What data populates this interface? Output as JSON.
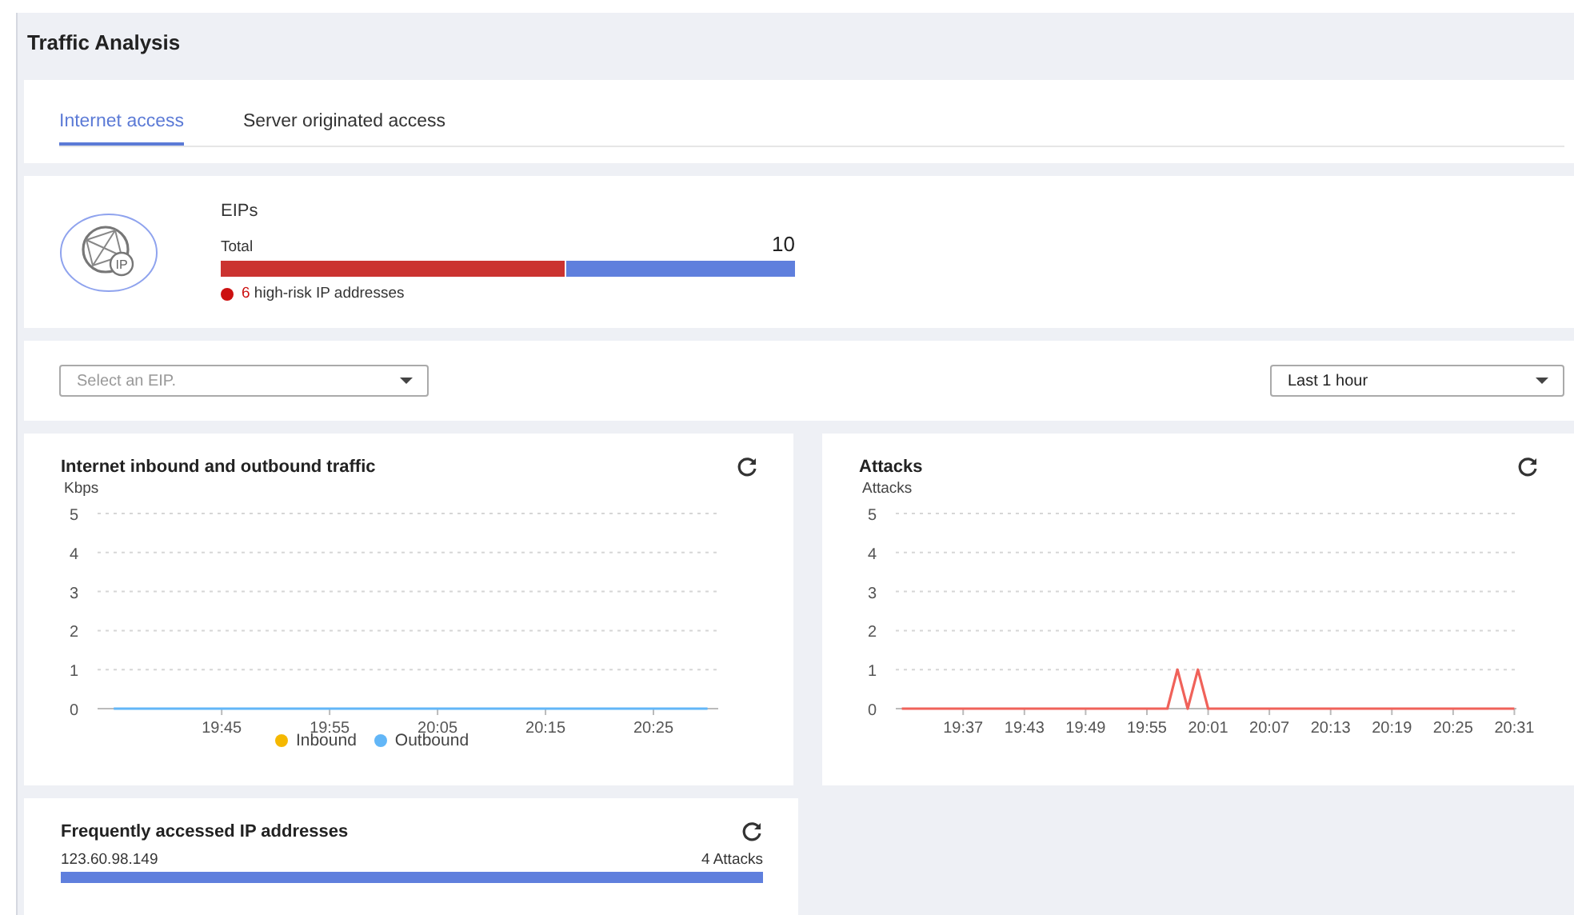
{
  "title": "Traffic Analysis",
  "tabs": [
    {
      "label": "Internet access",
      "selected": true
    },
    {
      "label": "Server originated access",
      "selected": false
    }
  ],
  "eips": {
    "heading": "EIPs",
    "icon_label": "IP",
    "total_label": "Total",
    "total": "10",
    "level": 0.6,
    "risk_count": "6",
    "risk_text": "high-risk IP addresses"
  },
  "filters": {
    "eip_select": {
      "placeholder": "Select an EIP."
    },
    "range_select": {
      "value": "Last 1 hour"
    }
  },
  "traffic": {
    "title": "Internet inbound and outbound traffic",
    "chart_data": {
      "type": "line",
      "ylabel": "Kbps",
      "categories": [
        null,
        null,
        "19:45",
        null,
        "19:55",
        null,
        "20:05",
        null,
        "20:15",
        null,
        "20:25",
        null
      ],
      "grid": true,
      "ylim": [
        0,
        5
      ],
      "yticks": [
        0,
        1,
        2,
        3,
        4,
        5
      ],
      "series": [
        {
          "name": "Inbound",
          "color": "#f5b800",
          "values": [
            null,
            null,
            null,
            null,
            null,
            null,
            null,
            null,
            null,
            null,
            null,
            null
          ]
        },
        {
          "name": "Outbound",
          "color": "#62b6f7",
          "values": [
            0,
            0,
            0,
            0,
            0,
            0,
            0,
            0,
            0,
            0,
            0,
            0
          ]
        }
      ]
    }
  },
  "attacks": {
    "title": "Attacks",
    "chart_data": {
      "type": "line",
      "ylabel": "Attacks",
      "categories": [
        null,
        null,
        null,
        null,
        null,
        null,
        "19:37",
        null,
        null,
        null,
        null,
        null,
        "19:43",
        null,
        null,
        null,
        null,
        null,
        "19:49",
        null,
        null,
        null,
        null,
        null,
        "19:55",
        null,
        null,
        null,
        null,
        null,
        "20:01",
        null,
        null,
        null,
        null,
        null,
        "20:07",
        null,
        null,
        null,
        null,
        null,
        "20:13",
        null,
        null,
        null,
        null,
        null,
        "20:19",
        null,
        null,
        null,
        null,
        null,
        "20:25",
        null,
        null,
        null,
        null,
        null,
        "20:31"
      ],
      "grid": true,
      "ylim": [
        0,
        5
      ],
      "yticks": [
        0,
        1,
        2,
        3,
        4,
        5
      ],
      "series": [
        {
          "color": "#f0625a",
          "values": [
            0,
            0,
            0,
            0,
            0,
            0,
            0,
            0,
            0,
            0,
            0,
            0,
            0,
            0,
            0,
            0,
            0,
            0,
            0,
            0,
            0,
            0,
            0,
            0,
            0,
            0,
            0,
            1,
            0,
            1,
            0,
            0,
            0,
            0,
            0,
            0,
            0,
            0,
            0,
            0,
            0,
            0,
            0,
            0,
            0,
            0,
            0,
            0,
            0,
            0,
            0,
            0,
            0,
            0,
            0,
            0,
            0,
            0,
            0,
            0,
            0
          ]
        }
      ]
    }
  },
  "frequent": {
    "title": "Frequently accessed IP addresses",
    "items": [
      {
        "ip": "123.60.98.149",
        "count": "4 Attacks",
        "level": 1
      }
    ]
  }
}
